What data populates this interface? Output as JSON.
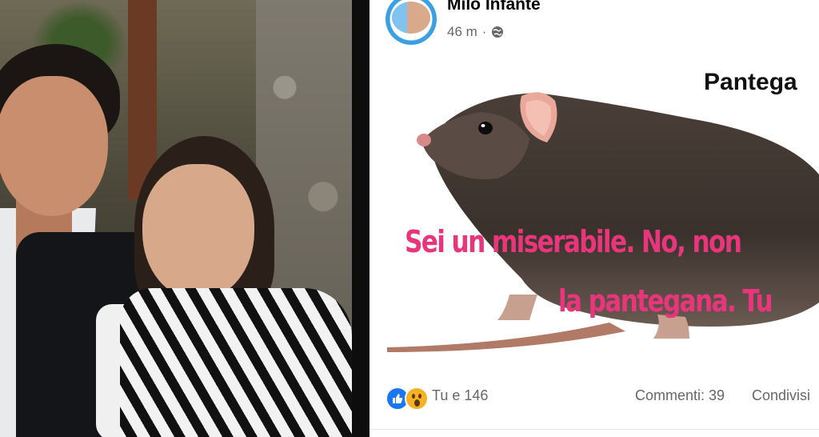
{
  "post": {
    "author": "Milo Infante",
    "time": "46 m",
    "separator": "·",
    "privacy_icon": "globe-icon",
    "image": {
      "title": "Pantega",
      "caption_line1": "Sei un miserabile.  No, non",
      "caption_line2": "la pantegana. Tu"
    },
    "reactions": {
      "icons": [
        "like-icon",
        "wow-icon"
      ],
      "summary": "Tu e 146"
    },
    "comments": "Commenti: 39",
    "shares": "Condivisi"
  },
  "colors": {
    "caption_pink": "#e8357b",
    "facebook_blue": "#1877f2",
    "meta_grey": "#65676b"
  }
}
